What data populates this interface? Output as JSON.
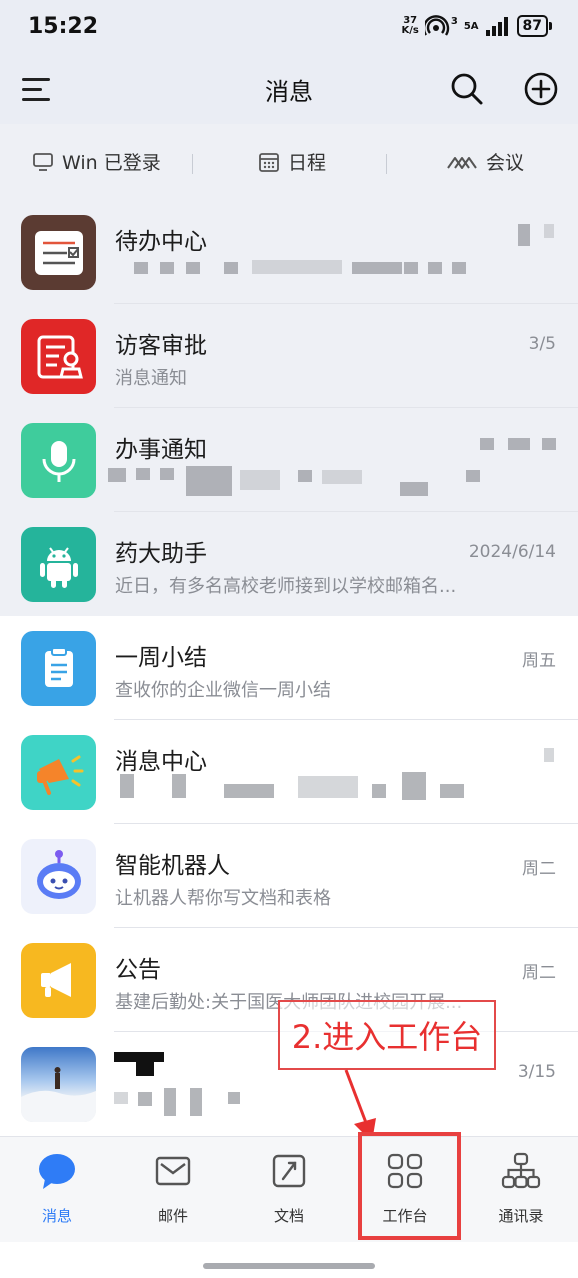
{
  "status_bar": {
    "time": "15:22",
    "net_speed_top": "37",
    "net_speed_bottom": "K/s",
    "signal_a": "3",
    "signal_b": "5A",
    "battery": "87"
  },
  "header": {
    "title": "消息"
  },
  "quick_bar": {
    "items": [
      {
        "label": "Win 已登录",
        "icon": "monitor-icon"
      },
      {
        "label": "日程",
        "icon": "calendar-icon"
      },
      {
        "label": "会议",
        "icon": "meeting-icon"
      }
    ]
  },
  "messages": [
    {
      "title": "待办中心",
      "subtitle": "",
      "time": "",
      "icon": "todo-icon",
      "color": "#5b3b32",
      "pinned": true
    },
    {
      "title": "访客审批",
      "subtitle": "消息通知",
      "time": "3/5",
      "icon": "visitor-approval-icon",
      "color": "#e02727",
      "pinned": true
    },
    {
      "title": "办事通知",
      "subtitle": "",
      "time": "",
      "icon": "microphone-icon",
      "color": "#3fcc9c",
      "pinned": true
    },
    {
      "title": "药大助手",
      "subtitle": "近日，有多名高校老师接到以学校邮箱名...",
      "time": "2024/6/14",
      "icon": "android-icon",
      "color": "#25b49b",
      "pinned": true
    },
    {
      "title": "一周小结",
      "subtitle": "查收你的企业微信一周小结",
      "time": "周五",
      "icon": "clipboard-icon",
      "color": "#39a3e6",
      "pinned": false
    },
    {
      "title": "消息中心",
      "subtitle": "",
      "time": "",
      "icon": "megaphone-icon",
      "color": "#3fd4c6",
      "pinned": false
    },
    {
      "title": "智能机器人",
      "subtitle": "让机器人帮你写文档和表格",
      "time": "周二",
      "icon": "robot-icon",
      "color": "#eef1fb",
      "pinned": false
    },
    {
      "title": "公告",
      "subtitle": "基建后勤处:关于国医大师团队进校园开展...",
      "time": "周二",
      "icon": "announcement-icon",
      "color": "#f7b820",
      "pinned": false
    },
    {
      "title": "",
      "subtitle": "",
      "time": "3/15",
      "icon": "photo-avatar",
      "color": "#8ab4e6",
      "pinned": false
    }
  ],
  "annotation": {
    "text": "2.进入工作台"
  },
  "tabs": [
    {
      "label": "消息",
      "icon": "chat-bubble-icon",
      "active": true
    },
    {
      "label": "邮件",
      "icon": "mail-icon",
      "active": false
    },
    {
      "label": "文档",
      "icon": "document-icon",
      "active": false
    },
    {
      "label": "工作台",
      "icon": "workbench-grid-icon",
      "active": false
    },
    {
      "label": "通讯录",
      "icon": "contacts-org-icon",
      "active": false
    }
  ],
  "colors": {
    "accent": "#2f7cf6",
    "annotation_red": "#e83030"
  }
}
